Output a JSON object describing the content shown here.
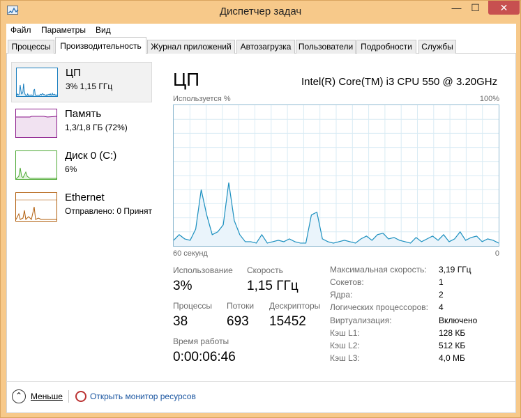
{
  "window": {
    "title": "Диспетчер задач",
    "min": "—",
    "max": "☐",
    "close": "✕"
  },
  "menu": [
    "Файл",
    "Параметры",
    "Вид"
  ],
  "tabs": [
    "Процессы",
    "Производительность",
    "Журнал приложений",
    "Автозагрузка",
    "Пользователи",
    "Подробности",
    "Службы"
  ],
  "sidebar": [
    {
      "title": "ЦП",
      "sub": "3% 1,15 ГГц",
      "color": "#1a7fbf"
    },
    {
      "title": "Память",
      "sub": "1,3/1,8 ГБ (72%)",
      "color": "#8b1a8b"
    },
    {
      "title": "Диск 0 (C:)",
      "sub": "6%",
      "color": "#4ca832"
    },
    {
      "title": "Ethernet",
      "sub": "Отправлено: 0 Принят",
      "color": "#b05c0a"
    }
  ],
  "main": {
    "title": "ЦП",
    "cpu_name": "Intel(R) Core(TM) i3 CPU 550 @ 3.20GHz",
    "graph_top_left": "Используется %",
    "graph_top_right": "100%",
    "graph_bottom_left": "60 секунд",
    "graph_bottom_right": "0"
  },
  "stats": {
    "usage_label": "Использование",
    "usage_value": "3%",
    "speed_label": "Скорость",
    "speed_value": "1,15 ГГц",
    "processes_label": "Процессы",
    "processes_value": "38",
    "threads_label": "Потоки",
    "threads_value": "693",
    "handles_label": "Дескрипторы",
    "handles_value": "15452",
    "uptime_label": "Время работы",
    "uptime_value": "0:00:06:46"
  },
  "specs": [
    {
      "label": "Максимальная скорость:",
      "value": "3,19 ГГц"
    },
    {
      "label": "Сокетов:",
      "value": "1"
    },
    {
      "label": "Ядра:",
      "value": "2"
    },
    {
      "label": "Логических процессоров:",
      "value": "4"
    },
    {
      "label": "Виртуализация:",
      "value": "Включено"
    },
    {
      "label": "Кэш L1:",
      "value": "128 КБ"
    },
    {
      "label": "Кэш L2:",
      "value": "512 КБ"
    },
    {
      "label": "Кэш L3:",
      "value": "4,0 МБ"
    }
  ],
  "footer": {
    "less_label": "Меньше",
    "resmon_label": "Открыть монитор ресурсов"
  },
  "chart_data": {
    "type": "line",
    "title": "",
    "xlabel": "",
    "ylabel": "",
    "xlim": [
      60,
      0
    ],
    "ylim": [
      0,
      100
    ],
    "grid": true,
    "series": [
      {
        "values": [
          4,
          8,
          5,
          4,
          12,
          40,
          22,
          8,
          10,
          15,
          45,
          18,
          8,
          3,
          3,
          2,
          8,
          2,
          3,
          4,
          3,
          5,
          3,
          2,
          2,
          22,
          24,
          5,
          3,
          2,
          3,
          4,
          3,
          2,
          5,
          7,
          4,
          8,
          9,
          5,
          6,
          4,
          3,
          2,
          6,
          3,
          5,
          7,
          4,
          8,
          3,
          5,
          10,
          4,
          6,
          7,
          3,
          5,
          4,
          2
        ]
      }
    ]
  }
}
